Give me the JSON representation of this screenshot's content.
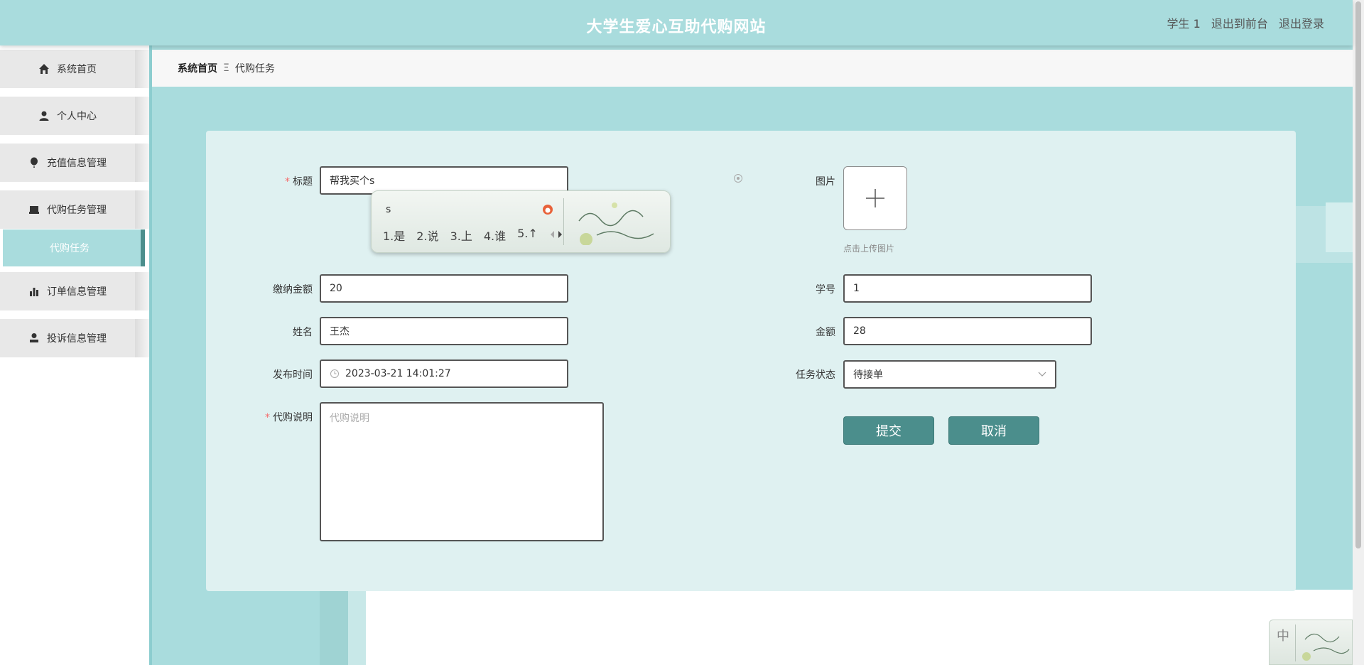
{
  "header": {
    "title": "大学生爱心互助代购网站",
    "user": "学生 1",
    "to_front": "退出到前台",
    "logout": "退出登录"
  },
  "sidebar": {
    "items": [
      {
        "label": "系统首页",
        "icon": "home-icon"
      },
      {
        "label": "个人中心",
        "icon": "user-icon"
      },
      {
        "label": "充值信息管理",
        "icon": "balloon-icon"
      },
      {
        "label": "代购任务管理",
        "icon": "tray-icon"
      },
      {
        "label": "订单信息管理",
        "icon": "bar-chart-icon"
      },
      {
        "label": "投诉信息管理",
        "icon": "person-icon"
      }
    ],
    "sub_active": "代购任务"
  },
  "breadcrumb": {
    "home": "系统首页",
    "sep": "Ξ",
    "current": "代购任务"
  },
  "form": {
    "title_label": "标题",
    "title_value": "帮我买个s",
    "image_label": "图片",
    "upload_hint": "点击上传图片",
    "fee_label": "缴纳金额",
    "fee_value": "20",
    "student_no_label": "学号",
    "student_no_value": "1",
    "name_label": "姓名",
    "name_value": "王杰",
    "amount_label": "金额",
    "amount_value": "28",
    "publish_time_label": "发布时间",
    "publish_time_value": "2023-03-21 14:01:27",
    "status_label": "任务状态",
    "status_value": "待接单",
    "desc_label": "代购说明",
    "desc_placeholder": "代购说明",
    "submit": "提交",
    "cancel": "取消"
  },
  "ime": {
    "typed": "s",
    "candidates": [
      "1.是",
      "2.说",
      "3.上",
      "4.谁",
      "5.↑"
    ],
    "tray_mode": "中"
  },
  "colors": {
    "accent": "#a9dcdd",
    "button": "#4b8e8c",
    "required": "#f56c6c"
  }
}
